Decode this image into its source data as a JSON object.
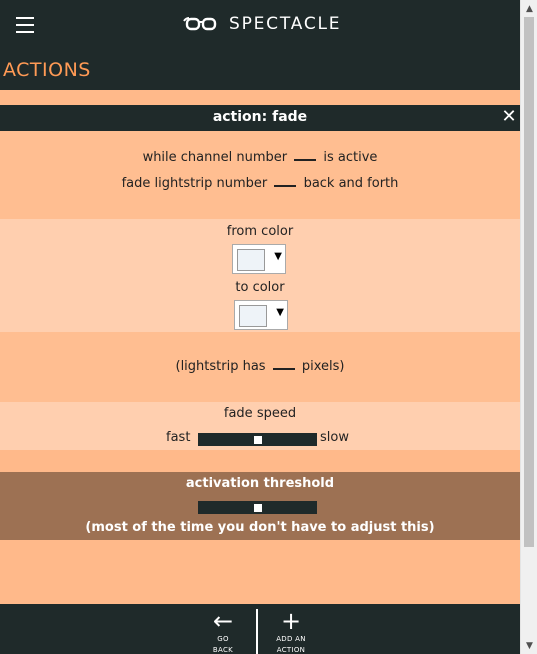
{
  "header": {
    "brand": "SPECTACLE",
    "section_title": "ACTIONS"
  },
  "action": {
    "title": "action: fade",
    "close_icon": "close-icon",
    "line1_pre": "while channel number",
    "line1_post": "is active",
    "line2_pre": "fade lightstrip number",
    "line2_post": "back and forth",
    "from_color_label": "from color",
    "to_color_label": "to color",
    "pixels_pre": "(lightstrip has",
    "pixels_post": "pixels)",
    "speed_label": "fade speed",
    "speed_fast": "fast",
    "speed_slow": "slow",
    "speed_value": 0.5,
    "threshold_label": "activation threshold",
    "threshold_value": 0.5,
    "threshold_note": "(most of the time you don't have to adjust this)"
  },
  "footer": {
    "go_back": [
      "GO",
      "BACK"
    ],
    "add_action": [
      "ADD AN",
      "ACTION"
    ]
  },
  "colors": {
    "dark": "#1f2a2a",
    "accent": "#ff9a55",
    "peach": "#ffb98a",
    "threshold_band": "#9d7153"
  }
}
